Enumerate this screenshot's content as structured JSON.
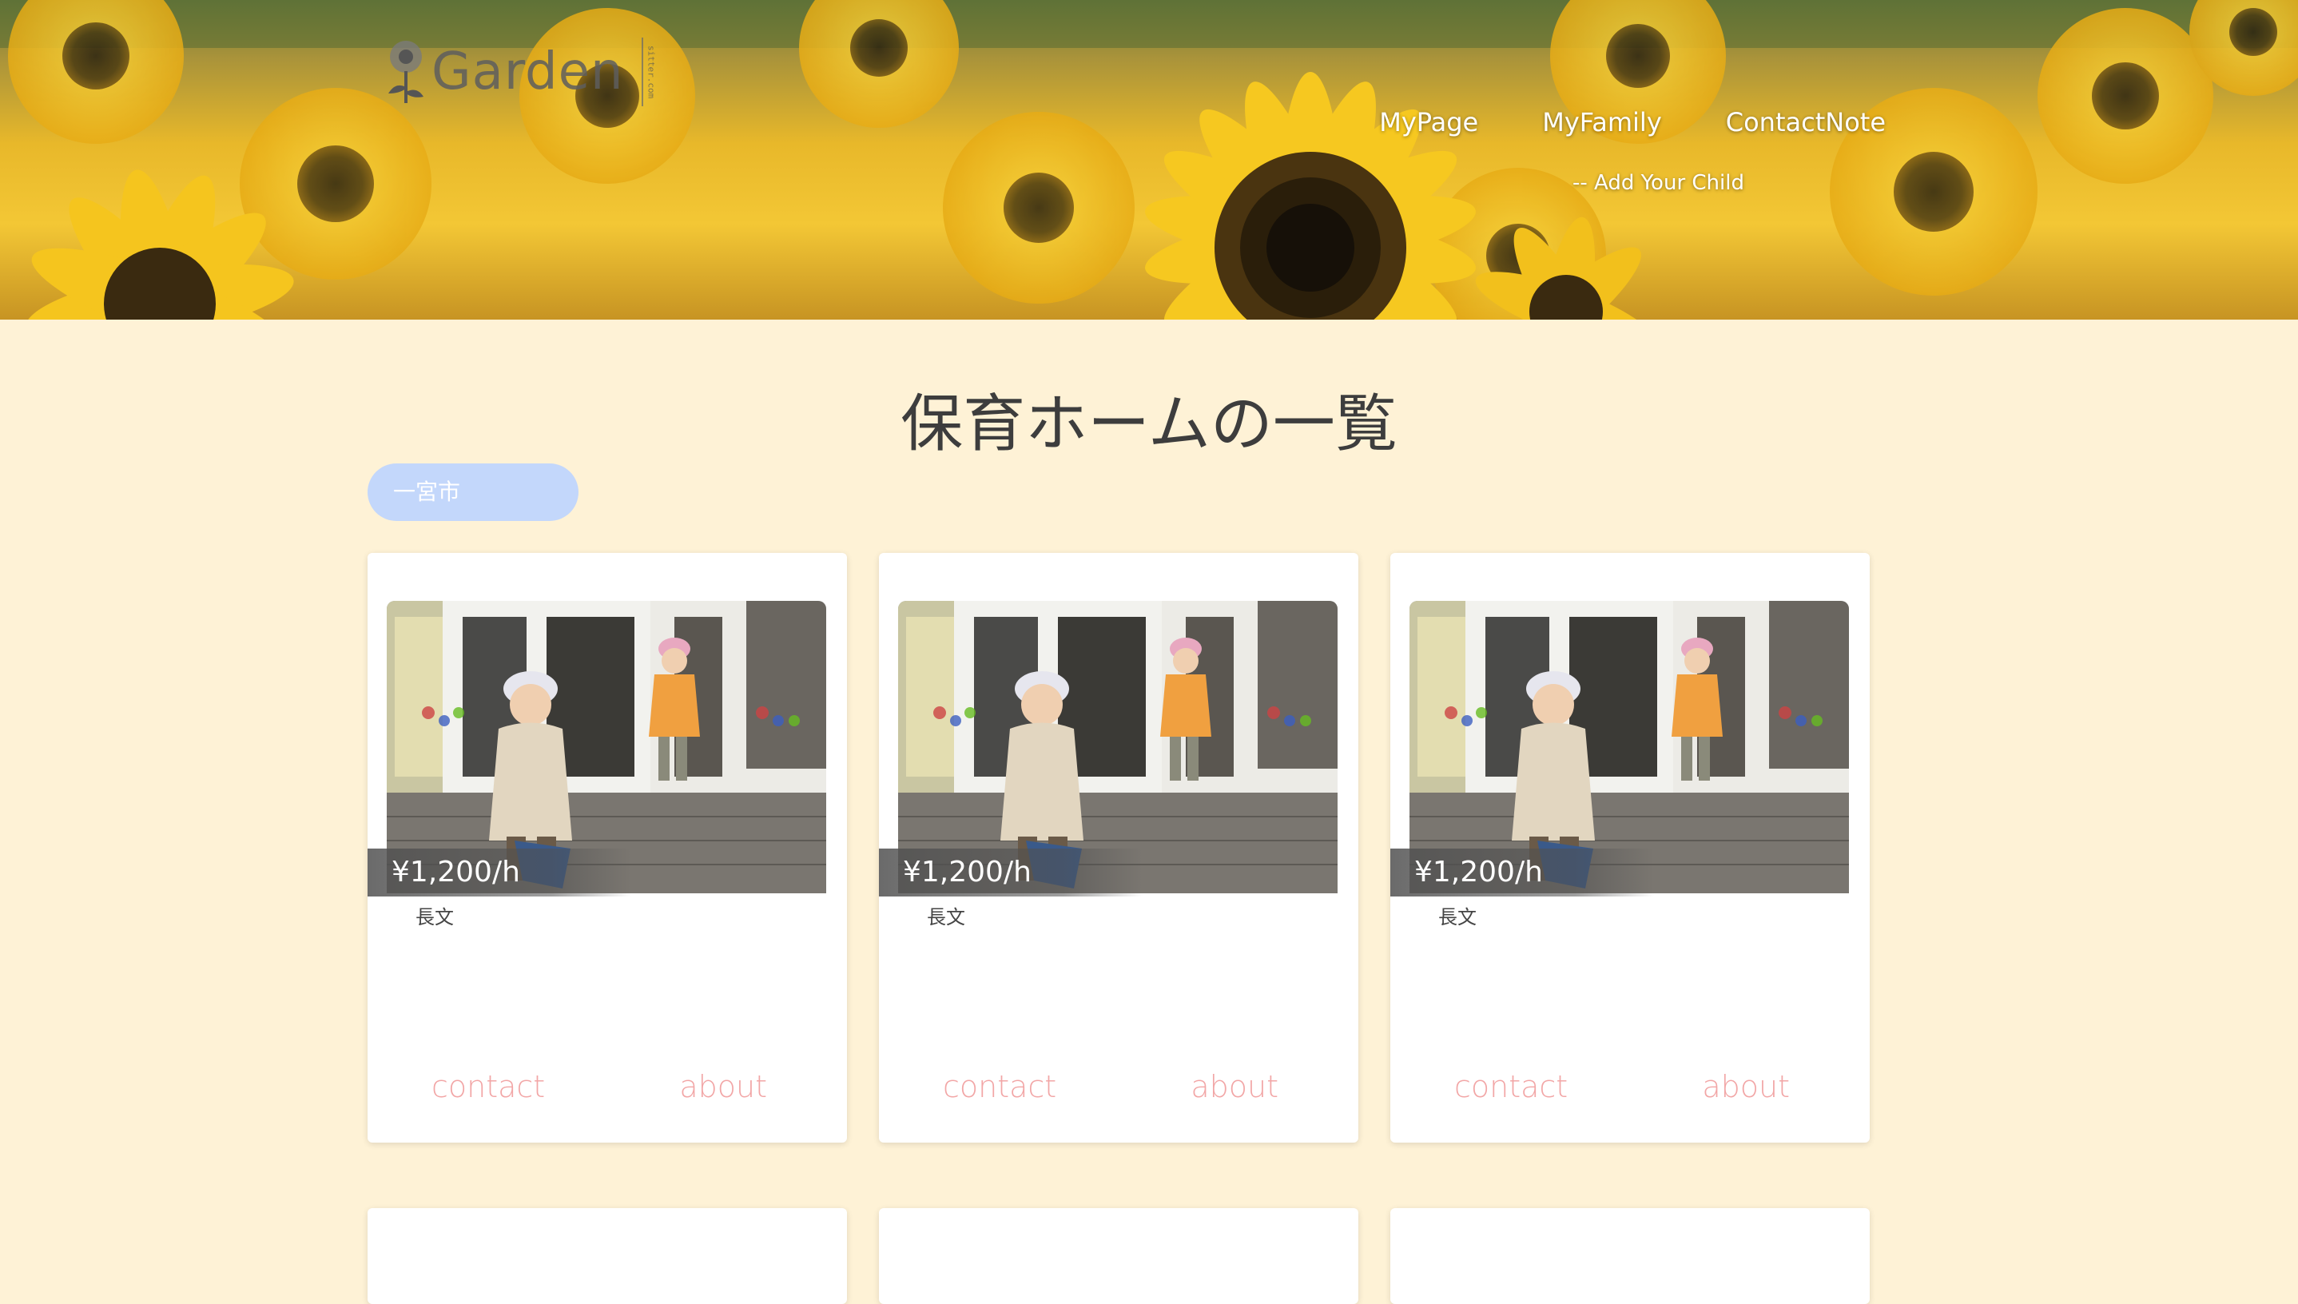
{
  "header": {
    "logo_text": "Garden",
    "logo_tag": "sitter.com",
    "nav": [
      {
        "label": "MyPage"
      },
      {
        "label": "MyFamily"
      },
      {
        "label": "ContactNote"
      }
    ],
    "subnav_label": "-- Add Your Child"
  },
  "main": {
    "title": "保育ホームの一覧",
    "city_select_value": "一宮市",
    "cards": [
      {
        "price": "¥1,200/h",
        "description": "長文",
        "contact_label": "contact",
        "about_label": "about"
      },
      {
        "price": "¥1,200/h",
        "description": "長文",
        "contact_label": "contact",
        "about_label": "about"
      },
      {
        "price": "¥1,200/h",
        "description": "長文",
        "contact_label": "contact",
        "about_label": "about"
      }
    ]
  },
  "colors": {
    "page_background": "#fef2d6",
    "city_select": "#c3d7fb",
    "card_link": "#f2a6a6",
    "title": "#3d3d3d"
  },
  "icons": {
    "logo": "sunflower-icon"
  }
}
